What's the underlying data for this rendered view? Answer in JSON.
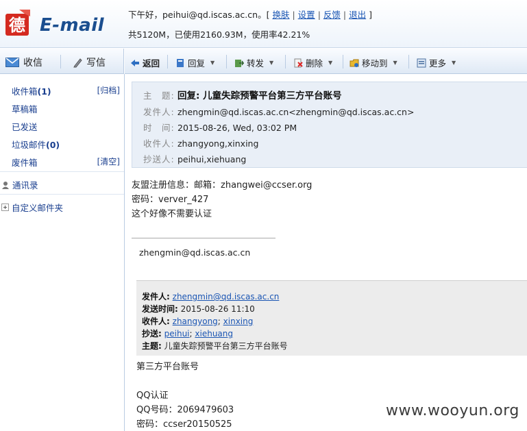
{
  "header": {
    "logo_char": "德",
    "logo_text": "E-mail",
    "greeting": "下午好，peihui@qd.iscas.ac.cn。[",
    "links": [
      "换肤",
      "设置",
      "反馈",
      "退出"
    ],
    "greeting_end": "]",
    "quota": "共5120M，已使用2160.93M，使用率42.21%"
  },
  "leftbar": {
    "inbox": "收信",
    "compose": "写信"
  },
  "toolbar": {
    "back": "返回",
    "reply": "回复",
    "forward": "转发",
    "delete": "删除",
    "move": "移动到",
    "more": "更多"
  },
  "sidebar": {
    "folders": [
      {
        "label": "收件箱",
        "count": "(1)",
        "action": "[归档]"
      },
      {
        "label": "草稿箱",
        "count": "",
        "action": ""
      },
      {
        "label": "已发送",
        "count": "",
        "action": ""
      },
      {
        "label": "垃圾邮件",
        "count": "(0)",
        "action": ""
      },
      {
        "label": "废件箱",
        "count": "",
        "action": "[清空]"
      }
    ],
    "contacts": "通讯录",
    "custom": "自定义邮件夹"
  },
  "message": {
    "labels": {
      "subject": "主　题:",
      "from": "发件人:",
      "time": "时　间:",
      "to": "收件人:",
      "cc": "抄送人:"
    },
    "subject": "回复: 儿童失踪预警平台第三方平台账号",
    "from": "zhengmin@qd.iscas.ac.cn<zhengmin@qd.iscas.ac.cn>",
    "time": "2015-08-26, Wed, 03:02 PM",
    "to": "zhangyong,xinxing",
    "cc": "peihui,xiehuang"
  },
  "body": {
    "line1": "友盟注册信息：邮箱：zhangwei@ccser.org",
    "line2": "密码：verver_427",
    "line3": "这个好像不需要认证",
    "signature": "zhengmin@qd.iscas.ac.cn"
  },
  "quote": {
    "from_label": "发件人:",
    "from": "zhengmin@qd.iscas.ac.cn",
    "time_label": "发送时间:",
    "time": "2015-08-26 11:10",
    "to_label": "收件人:",
    "to1": "zhangyong",
    "to2": "xinxing",
    "cc_label": "抄送:",
    "cc1": "peihui",
    "cc2": "xiehuang",
    "subject_label": "主题:",
    "subject": "儿童失踪预警平台第三方平台账号"
  },
  "quoted_body": {
    "line1": "第三方平台账号",
    "line2": "QQ认证",
    "line3": "QQ号码：2069479603",
    "line4": "密码：ccser20150525"
  },
  "watermark": "www.wooyun.org"
}
